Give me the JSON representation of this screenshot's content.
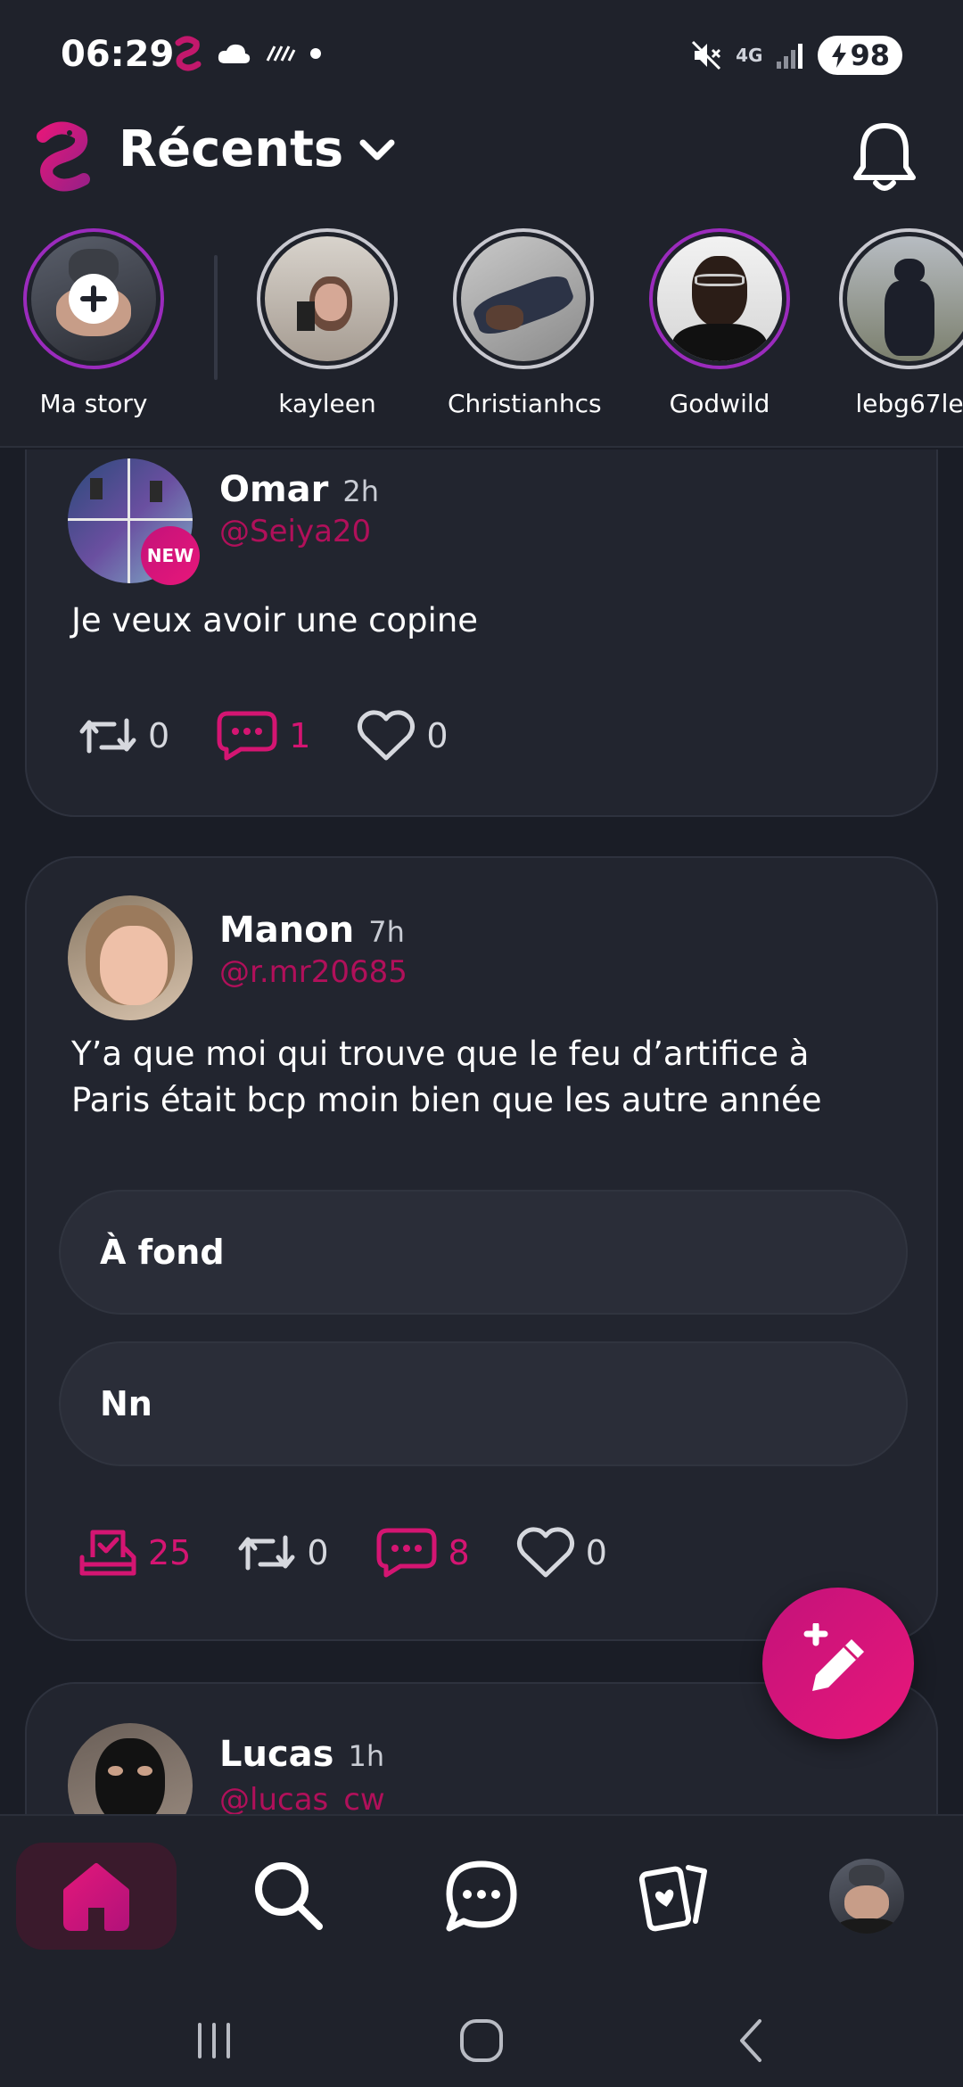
{
  "status_bar": {
    "time": "06:29",
    "network": "4G",
    "battery": "98"
  },
  "header": {
    "title": "Récents"
  },
  "stories": [
    {
      "name": "Ma story"
    },
    {
      "name": "kayleen"
    },
    {
      "name": "Christianhcs"
    },
    {
      "name": "Godwild"
    },
    {
      "name": "lebg67le"
    }
  ],
  "posts": [
    {
      "author": "Omar",
      "time": "2h",
      "handle": "@Seiya20",
      "badge": "NEW",
      "text": "Je veux avoir une copine",
      "reposts": "0",
      "comments": "1",
      "likes": "0"
    },
    {
      "author": "Manon",
      "time": "7h",
      "handle": "@r.mr20685",
      "text_line1": "Y’a que moi qui trouve que le feu d’artifice à",
      "text_line2": "Paris était bcp moin bien que les autre année",
      "poll_options": [
        "À fond",
        "Nn"
      ],
      "votes": "25",
      "reposts": "0",
      "comments": "8",
      "likes": "0"
    },
    {
      "author": "Lucas",
      "time": "1h",
      "handle": "@lucas_cw"
    }
  ],
  "colors": {
    "accent": "#d41572",
    "background": "#1a1d26",
    "card": "#22252f"
  }
}
